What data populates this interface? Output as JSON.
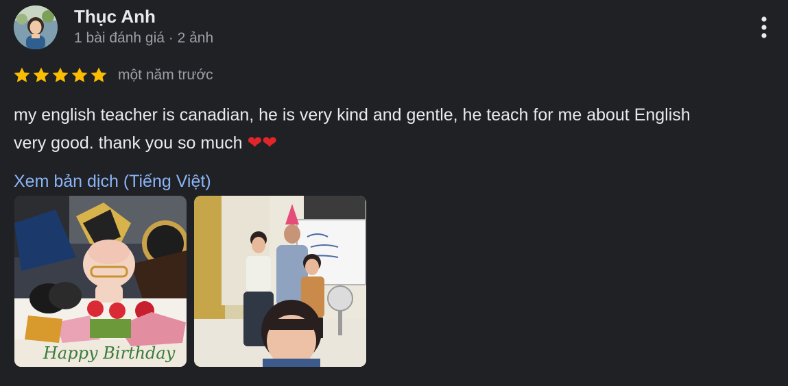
{
  "reviewer": {
    "name": "Thục Anh",
    "meta": "1 bài đánh giá · 2 ảnh",
    "avatar_icon": "avatar-photo"
  },
  "review": {
    "rating": 5,
    "max_rating": 5,
    "time": "một năm trước",
    "text_line1": "my english teacher is canadian, he is very kind and gentle, he teach for me about English",
    "text_line2": "very good. thank you so much ",
    "hearts": "❤❤",
    "translate_link": "Xem bản dịch (Tiếng Việt)"
  },
  "photos": [
    {
      "icon": "birthday-cake-photo",
      "cake_text": "Happy Birthday"
    },
    {
      "icon": "group-selfie-photo"
    }
  ],
  "menu_icon": "more-vert-icon",
  "colors": {
    "background": "#202124",
    "text": "#e8eaed",
    "secondary": "#9aa0a6",
    "star": "#fbbc04",
    "link": "#8ab4f8"
  }
}
